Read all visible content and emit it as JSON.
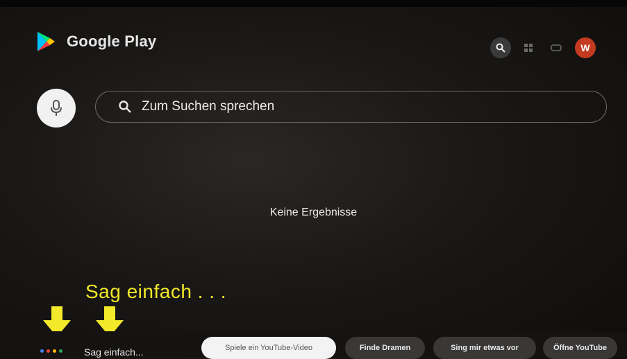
{
  "app": {
    "name": "Google Play"
  },
  "header": {
    "icons": [
      "search-icon",
      "apps-icon",
      "games-icon"
    ],
    "avatar_letter": "W",
    "avatar_color": "#c23a1f"
  },
  "search": {
    "prompt": "Zum Suchen sprechen"
  },
  "results": {
    "empty_message": "Keine Ergebnisse"
  },
  "annotation": {
    "text": "Sag einfach . . .",
    "color": "#f2e92b"
  },
  "assistant": {
    "hint": "Sag einfach...",
    "dot_colors": [
      "#4285f4",
      "#ea4335",
      "#fbbc05",
      "#34a853"
    ]
  },
  "suggestions": [
    {
      "label": "Spiele ein YouTube-Video"
    },
    {
      "label": "Finde Dramen"
    },
    {
      "label": "Sing mir etwas vor"
    },
    {
      "label": "Öffne YouTube"
    }
  ]
}
